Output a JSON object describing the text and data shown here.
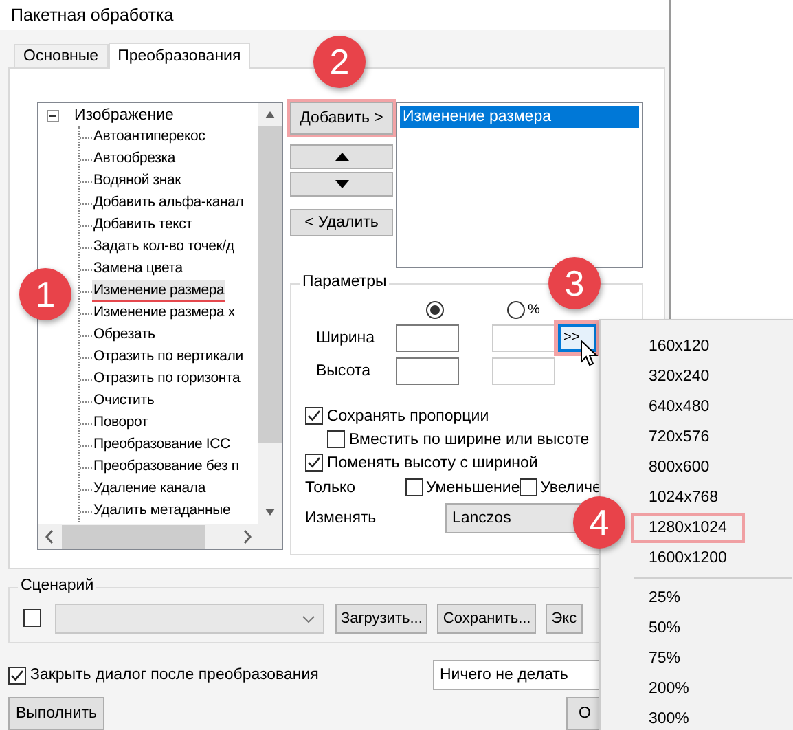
{
  "window": {
    "title": "Пакетная обработка"
  },
  "tabs": [
    {
      "label": "Основные",
      "selected": false
    },
    {
      "label": "Преобразования",
      "selected": true
    }
  ],
  "tree": {
    "label": "Изображение",
    "expanded": true,
    "children": [
      {
        "label": "Автоантиперекос",
        "selected": false
      },
      {
        "label": "Автообрезка",
        "selected": false
      },
      {
        "label": "Водяной знак",
        "selected": false
      },
      {
        "label": "Добавить альфа-канал",
        "selected": false
      },
      {
        "label": "Добавить текст",
        "selected": false
      },
      {
        "label": "Задать кол-во точек/д",
        "selected": false
      },
      {
        "label": "Замена цвета",
        "selected": false
      },
      {
        "label": "Изменение размера",
        "selected": true
      },
      {
        "label": "Изменение размера х",
        "selected": false
      },
      {
        "label": "Обрезать",
        "selected": false
      },
      {
        "label": "Отразить по вертикали",
        "selected": false
      },
      {
        "label": "Отразить по горизонта",
        "selected": false
      },
      {
        "label": "Очистить",
        "selected": false
      },
      {
        "label": "Поворот",
        "selected": false
      },
      {
        "label": "Преобразование ICC",
        "selected": false
      },
      {
        "label": "Преобразование без п",
        "selected": false
      },
      {
        "label": "Удаление канала",
        "selected": false
      },
      {
        "label": "Удалить метаданные",
        "selected": false
      }
    ]
  },
  "actions": {
    "add": {
      "label": "Добавить >",
      "highlighted": true
    },
    "remove": {
      "label": "< Удалить"
    }
  },
  "applied_list": [
    {
      "label": "Изменение размера",
      "selected": true
    }
  ],
  "parameters": {
    "title": "Параметры",
    "modes": [
      {
        "selected": true
      },
      {
        "label": "%",
        "selected": false
      }
    ],
    "width_label": "Ширина",
    "height_label": "Высота",
    "presets_button": {
      "label": ">>",
      "highlighted": true
    },
    "checks": [
      {
        "label": "Сохранять пропорции",
        "checked": true,
        "children": [
          {
            "label": "Вместить по ширине или высоте",
            "checked": false
          }
        ]
      },
      {
        "label": "Поменять высоту с шириной",
        "checked": true
      }
    ],
    "only": {
      "label": "Только",
      "options": [
        {
          "label": "Уменьшение",
          "checked": false
        },
        {
          "label": "Увеличе",
          "checked": false
        }
      ]
    },
    "resample": {
      "label": "Изменять",
      "value": "Lanczos"
    }
  },
  "scenario": {
    "title": "Сценарий",
    "checked": false,
    "buttons": [
      "Загрузить...",
      "Сохранить...",
      "Экс"
    ]
  },
  "close_after": {
    "label": "Закрыть диалог после преобразования",
    "checked": true
  },
  "after_action": {
    "value": "Ничего не делать"
  },
  "buttons": [
    "Выполнить",
    "О"
  ],
  "preset_menu": {
    "items": [
      {
        "kind": "item",
        "label": "160x120",
        "highlighted": false
      },
      {
        "kind": "item",
        "label": "320x240",
        "highlighted": false
      },
      {
        "kind": "item",
        "label": "640x480",
        "highlighted": false
      },
      {
        "kind": "item",
        "label": "720x576",
        "highlighted": false
      },
      {
        "kind": "item",
        "label": "800x600",
        "highlighted": false
      },
      {
        "kind": "item",
        "label": "1024x768",
        "highlighted": false
      },
      {
        "kind": "item",
        "label": "1280x1024",
        "highlighted": true
      },
      {
        "kind": "item",
        "label": "1600x1200",
        "highlighted": false
      },
      {
        "kind": "separator"
      },
      {
        "kind": "item",
        "label": "25%",
        "highlighted": false
      },
      {
        "kind": "item",
        "label": "50%",
        "highlighted": false
      },
      {
        "kind": "item",
        "label": "75%",
        "highlighted": false
      },
      {
        "kind": "item",
        "label": "200%",
        "highlighted": false
      },
      {
        "kind": "item",
        "label": "300%",
        "highlighted": false
      }
    ]
  },
  "callouts": [
    {
      "number": "1"
    },
    {
      "number": "2"
    },
    {
      "number": "3"
    },
    {
      "number": "4"
    }
  ]
}
